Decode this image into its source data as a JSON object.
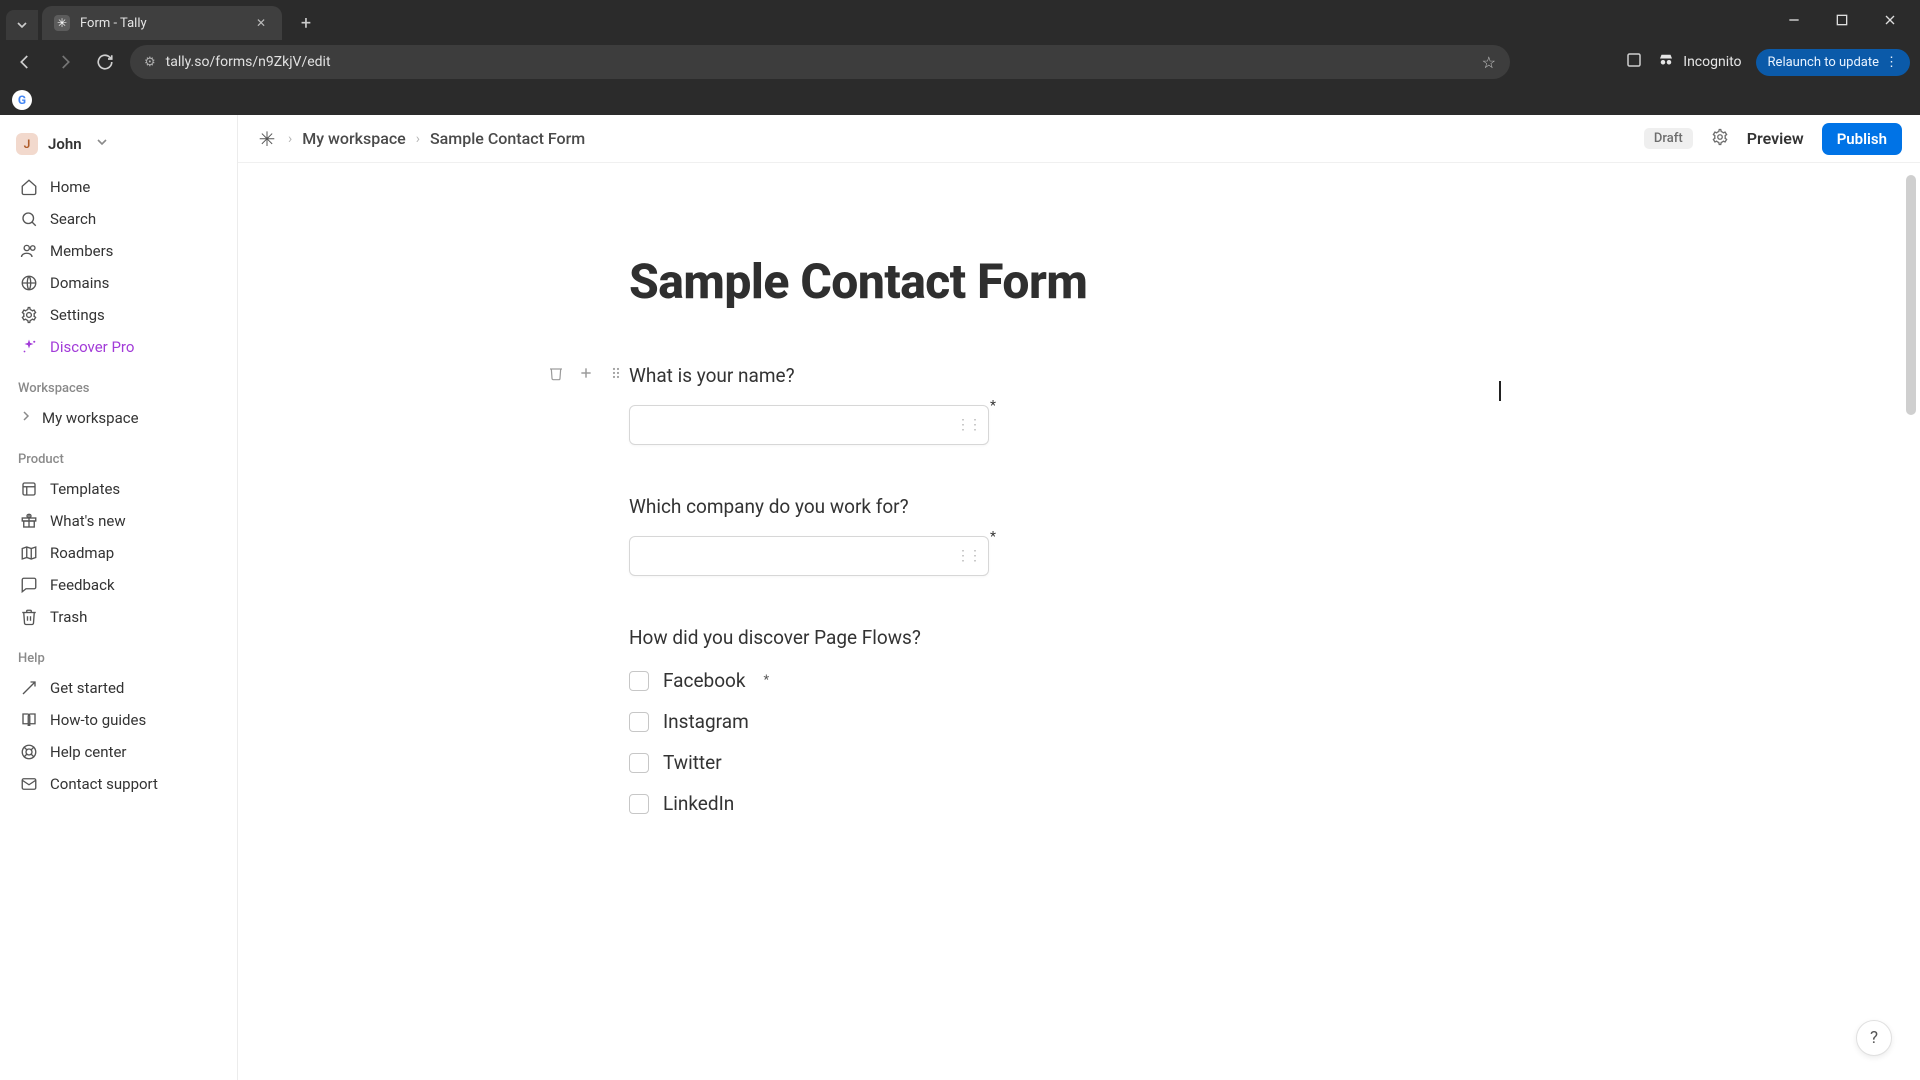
{
  "browser": {
    "tab_title": "Form - Tally",
    "url": "tally.so/forms/n9ZkjV/edit",
    "incognito_label": "Incognito",
    "relaunch_label": "Relaunch to update"
  },
  "user": {
    "initial": "J",
    "name": "John"
  },
  "sidebar": {
    "nav": [
      {
        "key": "home",
        "label": "Home"
      },
      {
        "key": "search",
        "label": "Search"
      },
      {
        "key": "members",
        "label": "Members"
      },
      {
        "key": "domains",
        "label": "Domains"
      },
      {
        "key": "settings",
        "label": "Settings"
      },
      {
        "key": "discover-pro",
        "label": "Discover Pro"
      }
    ],
    "workspaces_heading": "Workspaces",
    "workspace_name": "My workspace",
    "product_heading": "Product",
    "product": [
      {
        "key": "templates",
        "label": "Templates"
      },
      {
        "key": "whats-new",
        "label": "What's new"
      },
      {
        "key": "roadmap",
        "label": "Roadmap"
      },
      {
        "key": "feedback",
        "label": "Feedback"
      },
      {
        "key": "trash",
        "label": "Trash"
      }
    ],
    "help_heading": "Help",
    "help": [
      {
        "key": "get-started",
        "label": "Get started"
      },
      {
        "key": "how-to-guides",
        "label": "How-to guides"
      },
      {
        "key": "help-center",
        "label": "Help center"
      },
      {
        "key": "contact-support",
        "label": "Contact support"
      }
    ]
  },
  "topbar": {
    "breadcrumb_workspace": "My workspace",
    "breadcrumb_form": "Sample Contact Form",
    "draft_badge": "Draft",
    "preview_label": "Preview",
    "publish_label": "Publish"
  },
  "form": {
    "title": "Sample Contact Form",
    "q1_label": "What is your name?",
    "q2_label": "Which company do you work for?",
    "q3_label": "How did you discover Page Flows?",
    "q3_options": [
      "Facebook",
      "Instagram",
      "Twitter",
      "LinkedIn"
    ],
    "required_marker": "*"
  },
  "help_fab": "?"
}
